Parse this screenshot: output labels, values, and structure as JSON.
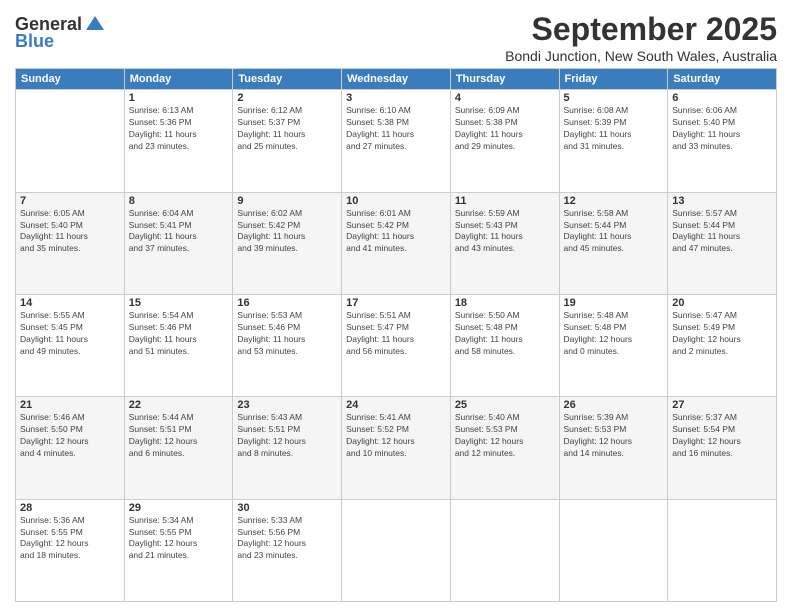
{
  "logo": {
    "general": "General",
    "blue": "Blue"
  },
  "title": "September 2025",
  "location": "Bondi Junction, New South Wales, Australia",
  "weekdays": [
    "Sunday",
    "Monday",
    "Tuesday",
    "Wednesday",
    "Thursday",
    "Friday",
    "Saturday"
  ],
  "weeks": [
    [
      {
        "day": "",
        "info": ""
      },
      {
        "day": "1",
        "info": "Sunrise: 6:13 AM\nSunset: 5:36 PM\nDaylight: 11 hours\nand 23 minutes."
      },
      {
        "day": "2",
        "info": "Sunrise: 6:12 AM\nSunset: 5:37 PM\nDaylight: 11 hours\nand 25 minutes."
      },
      {
        "day": "3",
        "info": "Sunrise: 6:10 AM\nSunset: 5:38 PM\nDaylight: 11 hours\nand 27 minutes."
      },
      {
        "day": "4",
        "info": "Sunrise: 6:09 AM\nSunset: 5:38 PM\nDaylight: 11 hours\nand 29 minutes."
      },
      {
        "day": "5",
        "info": "Sunrise: 6:08 AM\nSunset: 5:39 PM\nDaylight: 11 hours\nand 31 minutes."
      },
      {
        "day": "6",
        "info": "Sunrise: 6:06 AM\nSunset: 5:40 PM\nDaylight: 11 hours\nand 33 minutes."
      }
    ],
    [
      {
        "day": "7",
        "info": "Sunrise: 6:05 AM\nSunset: 5:40 PM\nDaylight: 11 hours\nand 35 minutes."
      },
      {
        "day": "8",
        "info": "Sunrise: 6:04 AM\nSunset: 5:41 PM\nDaylight: 11 hours\nand 37 minutes."
      },
      {
        "day": "9",
        "info": "Sunrise: 6:02 AM\nSunset: 5:42 PM\nDaylight: 11 hours\nand 39 minutes."
      },
      {
        "day": "10",
        "info": "Sunrise: 6:01 AM\nSunset: 5:42 PM\nDaylight: 11 hours\nand 41 minutes."
      },
      {
        "day": "11",
        "info": "Sunrise: 5:59 AM\nSunset: 5:43 PM\nDaylight: 11 hours\nand 43 minutes."
      },
      {
        "day": "12",
        "info": "Sunrise: 5:58 AM\nSunset: 5:44 PM\nDaylight: 11 hours\nand 45 minutes."
      },
      {
        "day": "13",
        "info": "Sunrise: 5:57 AM\nSunset: 5:44 PM\nDaylight: 11 hours\nand 47 minutes."
      }
    ],
    [
      {
        "day": "14",
        "info": "Sunrise: 5:55 AM\nSunset: 5:45 PM\nDaylight: 11 hours\nand 49 minutes."
      },
      {
        "day": "15",
        "info": "Sunrise: 5:54 AM\nSunset: 5:46 PM\nDaylight: 11 hours\nand 51 minutes."
      },
      {
        "day": "16",
        "info": "Sunrise: 5:53 AM\nSunset: 5:46 PM\nDaylight: 11 hours\nand 53 minutes."
      },
      {
        "day": "17",
        "info": "Sunrise: 5:51 AM\nSunset: 5:47 PM\nDaylight: 11 hours\nand 56 minutes."
      },
      {
        "day": "18",
        "info": "Sunrise: 5:50 AM\nSunset: 5:48 PM\nDaylight: 11 hours\nand 58 minutes."
      },
      {
        "day": "19",
        "info": "Sunrise: 5:48 AM\nSunset: 5:48 PM\nDaylight: 12 hours\nand 0 minutes."
      },
      {
        "day": "20",
        "info": "Sunrise: 5:47 AM\nSunset: 5:49 PM\nDaylight: 12 hours\nand 2 minutes."
      }
    ],
    [
      {
        "day": "21",
        "info": "Sunrise: 5:46 AM\nSunset: 5:50 PM\nDaylight: 12 hours\nand 4 minutes."
      },
      {
        "day": "22",
        "info": "Sunrise: 5:44 AM\nSunset: 5:51 PM\nDaylight: 12 hours\nand 6 minutes."
      },
      {
        "day": "23",
        "info": "Sunrise: 5:43 AM\nSunset: 5:51 PM\nDaylight: 12 hours\nand 8 minutes."
      },
      {
        "day": "24",
        "info": "Sunrise: 5:41 AM\nSunset: 5:52 PM\nDaylight: 12 hours\nand 10 minutes."
      },
      {
        "day": "25",
        "info": "Sunrise: 5:40 AM\nSunset: 5:53 PM\nDaylight: 12 hours\nand 12 minutes."
      },
      {
        "day": "26",
        "info": "Sunrise: 5:39 AM\nSunset: 5:53 PM\nDaylight: 12 hours\nand 14 minutes."
      },
      {
        "day": "27",
        "info": "Sunrise: 5:37 AM\nSunset: 5:54 PM\nDaylight: 12 hours\nand 16 minutes."
      }
    ],
    [
      {
        "day": "28",
        "info": "Sunrise: 5:36 AM\nSunset: 5:55 PM\nDaylight: 12 hours\nand 18 minutes."
      },
      {
        "day": "29",
        "info": "Sunrise: 5:34 AM\nSunset: 5:55 PM\nDaylight: 12 hours\nand 21 minutes."
      },
      {
        "day": "30",
        "info": "Sunrise: 5:33 AM\nSunset: 5:56 PM\nDaylight: 12 hours\nand 23 minutes."
      },
      {
        "day": "",
        "info": ""
      },
      {
        "day": "",
        "info": ""
      },
      {
        "day": "",
        "info": ""
      },
      {
        "day": "",
        "info": ""
      }
    ]
  ]
}
